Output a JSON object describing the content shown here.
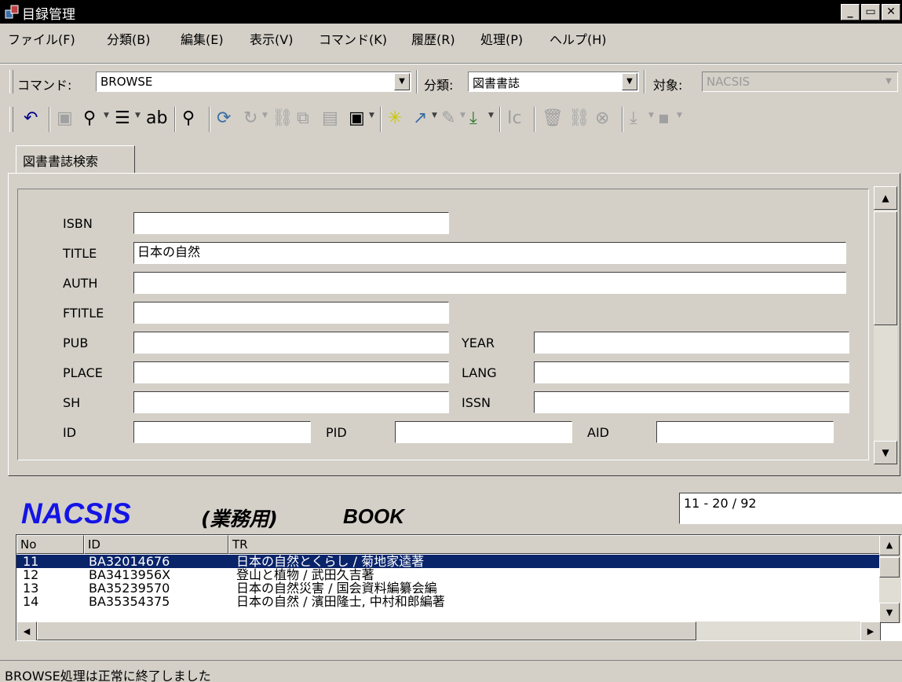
{
  "window": {
    "title": "目録管理"
  },
  "menu": [
    "ファイル(F)",
    "分類(B)",
    "編集(E)",
    "表示(V)",
    "コマンド(K)",
    "履歴(R)",
    "処理(P)",
    "ヘルプ(H)"
  ],
  "command_bar": {
    "command_label": "コマンド:",
    "command_value": "BROWSE",
    "category_label": "分類:",
    "category_value": "図書書誌",
    "target_label": "対象:",
    "target_value": "NACSIS"
  },
  "tab": {
    "label": "図書書誌検索"
  },
  "form": {
    "isbn_label": "ISBN",
    "isbn_value": "",
    "title_label": "TITLE",
    "title_value": "日本の自然",
    "auth_label": "AUTH",
    "auth_value": "",
    "ftitle_label": "FTITLE",
    "ftitle_value": "",
    "pub_label": "PUB",
    "pub_value": "",
    "year_label": "YEAR",
    "year_value": "",
    "place_label": "PLACE",
    "place_value": "",
    "lang_label": "LANG",
    "lang_value": "",
    "sh_label": "SH",
    "sh_value": "",
    "issn_label": "ISSN",
    "issn_value": "",
    "id_label": "ID",
    "id_value": "",
    "pid_label": "PID",
    "pid_value": "",
    "aid_label": "AID",
    "aid_value": ""
  },
  "results": {
    "logo": "NACSIS",
    "subtitle": "(業務用)",
    "book_label": "BOOK",
    "range": "11 - 20 / 92",
    "columns": [
      "No",
      "ID",
      "TR"
    ],
    "rows": [
      {
        "no": "11",
        "id": "BA32014676",
        "tr": "日本の自然とくらし / 菊地家逵著"
      },
      {
        "no": "12",
        "id": "BA3413956X",
        "tr": "登山と植物 / 武田久吉著"
      },
      {
        "no": "13",
        "id": "BA35239570",
        "tr": "日本の自然災害 / 国会資料編纂会編"
      },
      {
        "no": "14",
        "id": "BA35354375",
        "tr": "日本の自然 / 濱田隆士, 中村和郎編著"
      }
    ]
  },
  "status": {
    "message": "BROWSE処理は正常に終了しました"
  }
}
